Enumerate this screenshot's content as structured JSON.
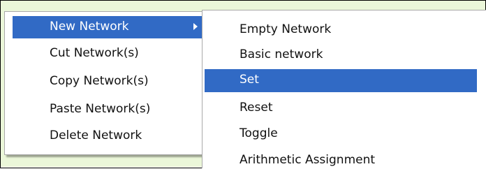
{
  "context_menu": {
    "items": [
      {
        "label": "New Network",
        "highlighted": true,
        "has_submenu": true
      },
      {
        "label": "Cut Network(s)"
      },
      {
        "label": "Copy Network(s)"
      },
      {
        "label": "Paste Network(s)"
      },
      {
        "label": "Delete Network"
      }
    ]
  },
  "submenu": {
    "items": [
      {
        "label": "Empty Network"
      },
      {
        "label": "Basic network"
      },
      {
        "label": "Set",
        "highlighted": true
      },
      {
        "label": "Reset"
      },
      {
        "label": "Toggle"
      },
      {
        "label": "Arithmetic Assignment"
      }
    ]
  },
  "colors": {
    "highlight": "#316ac5",
    "background": "#ebf7d9"
  }
}
